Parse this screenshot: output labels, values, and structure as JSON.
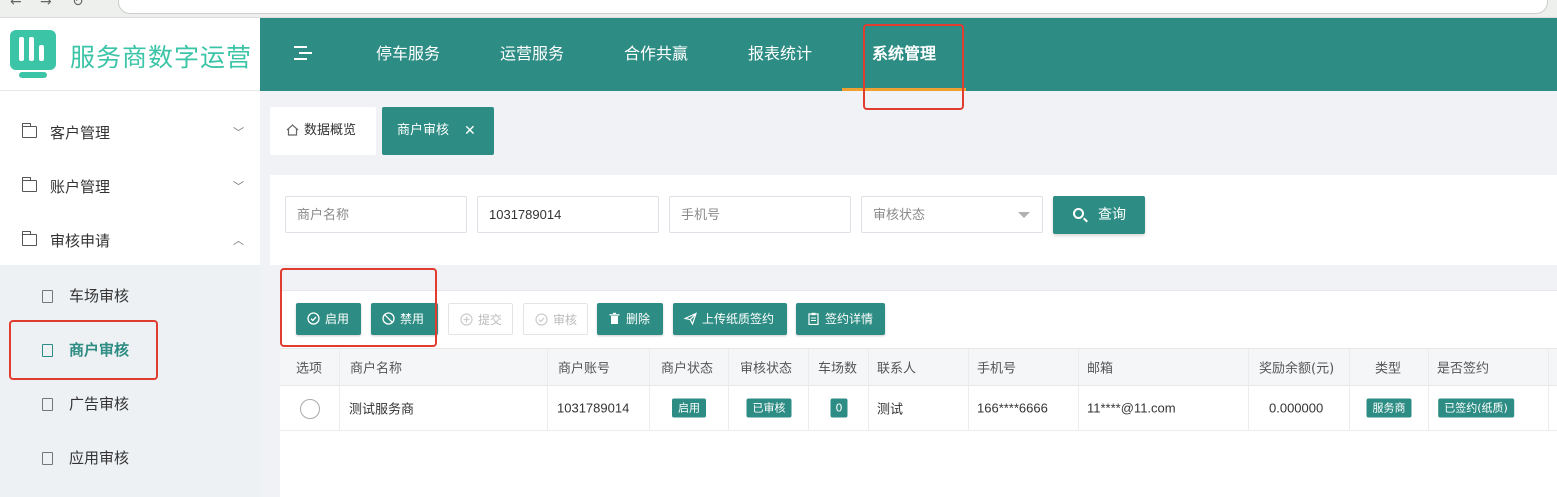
{
  "app": {
    "title": "服务商数字运营"
  },
  "topnav": {
    "items": [
      {
        "label": "停车服务",
        "active": false
      },
      {
        "label": "运营服务",
        "active": false
      },
      {
        "label": "合作共赢",
        "active": false
      },
      {
        "label": "报表统计",
        "active": false
      },
      {
        "label": "系统管理",
        "active": true
      }
    ]
  },
  "sidebar": {
    "groups": [
      {
        "label": "客户管理",
        "expanded": false
      },
      {
        "label": "账户管理",
        "expanded": false
      },
      {
        "label": "审核申请",
        "expanded": true
      }
    ],
    "subitems": [
      {
        "label": "车场审核",
        "active": false
      },
      {
        "label": "商户审核",
        "active": true
      },
      {
        "label": "广告审核",
        "active": false
      },
      {
        "label": "应用审核",
        "active": false
      }
    ]
  },
  "tabs": {
    "home": "数据概览",
    "current": "商户审核",
    "close_symbol": "✕"
  },
  "search": {
    "merchant_name_placeholder": "商户名称",
    "account_value": "1031789014",
    "phone_placeholder": "手机号",
    "audit_status_placeholder": "审核状态",
    "query_button": "查询"
  },
  "toolbar": {
    "enable": "启用",
    "disable": "禁用",
    "submit": "提交",
    "audit": "审核",
    "delete": "删除",
    "upload_paper_contract": "上传纸质签约",
    "contract_detail": "签约详情"
  },
  "table": {
    "headers": {
      "select": "选项",
      "merchant_name": "商户名称",
      "account": "商户账号",
      "merchant_status": "商户状态",
      "audit_status": "审核状态",
      "lot_count": "车场数",
      "contact": "联系人",
      "phone": "手机号",
      "email": "邮箱",
      "reward_balance": "奖励余额(元)",
      "type": "类型",
      "signed": "是否签约"
    },
    "rows": [
      {
        "merchant_name": "测试服务商",
        "account": "1031789014",
        "merchant_status": "启用",
        "audit_status": "已审核",
        "lot_count": "0",
        "contact": "测试",
        "phone": "166****6666",
        "email": "11****@11.com",
        "reward_balance": "0.000000",
        "type": "服务商",
        "signed": "已签约(纸质)"
      }
    ]
  },
  "colors": {
    "primary": "#2d8c83",
    "logo": "#3cc4a7",
    "active_underline": "#f0a030",
    "highlight_box": "#e03c30"
  }
}
